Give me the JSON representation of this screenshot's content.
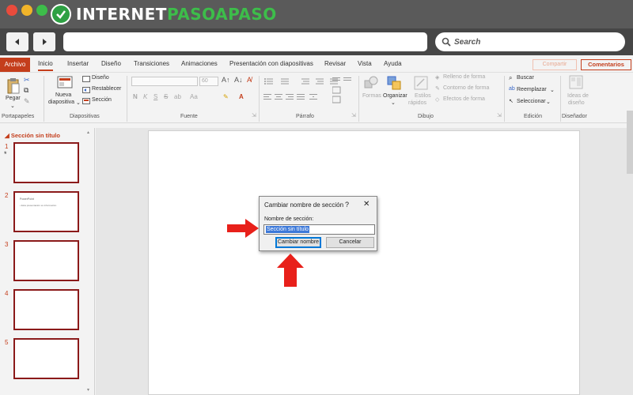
{
  "site": {
    "logo_text_white": "INTERNET",
    "logo_text_green": "PASOAPASO"
  },
  "browser": {
    "search_label": "Search",
    "url": ""
  },
  "ribbon_tabs": {
    "file": "Archivo",
    "items": [
      "Inicio",
      "Insertar",
      "Diseño",
      "Transiciones",
      "Animaciones",
      "Presentación con diapositivas",
      "Revisar",
      "Vista",
      "Ayuda"
    ],
    "active": "Inicio",
    "share": "Compartir",
    "comments": "Comentarios"
  },
  "ribbon": {
    "portapapeles": {
      "paste": "Pegar",
      "label": "Portapapeles"
    },
    "diapositivas": {
      "new_slide_1": "Nueva",
      "new_slide_2": "diapositiva",
      "layout": "Diseño",
      "reset": "Restablecer",
      "section": "Sección",
      "label": "Diapositivas"
    },
    "fuente": {
      "size": "60",
      "label": "Fuente",
      "bold": "N",
      "italic": "K",
      "underline": "S",
      "strike": "S",
      "spacing": "ab"
    },
    "parrafo": {
      "label": "Párrafo"
    },
    "dibujo": {
      "shapes": "Formas",
      "arrange": "Organizar",
      "quick_styles_1": "Estilos",
      "quick_styles_2": "rápidos",
      "fill": "Relleno de forma",
      "outline": "Contorno de forma",
      "effects": "Efectos de forma",
      "label": "Dibujo"
    },
    "edicion": {
      "find": "Buscar",
      "replace": "Reemplazar",
      "select": "Seleccionar",
      "label": "Edición"
    },
    "disenador": {
      "ideas_1": "Ideas de",
      "ideas_2": "diseño",
      "label": "Diseñador"
    }
  },
  "thumbnails": {
    "section_title": "Sección sin título",
    "slides": [
      {
        "num": "1",
        "title": "",
        "bullet": ""
      },
      {
        "num": "2",
        "title": "PowerPoint",
        "bullet": "• Esta presentación es información"
      },
      {
        "num": "3",
        "title": "",
        "bullet": ""
      },
      {
        "num": "4",
        "title": "",
        "bullet": ""
      },
      {
        "num": "5",
        "title": "",
        "bullet": ""
      }
    ]
  },
  "dialog": {
    "title": "Cambiar nombre de sección",
    "help": "?",
    "close": "✕",
    "field_label": "Nombre de sección:",
    "field_value": "Sección sin título",
    "ok": "Cambiar nombre",
    "cancel": "Cancelar"
  },
  "colors": {
    "accent": "#c43e1c",
    "arrow": "#e8201a",
    "selection": "#3c78d8"
  }
}
